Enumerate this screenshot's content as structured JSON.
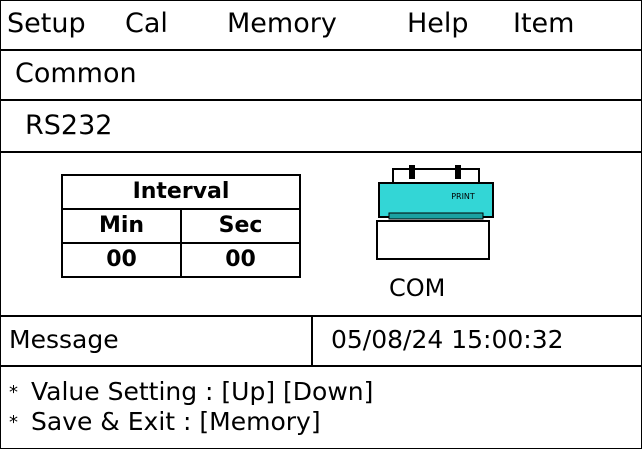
{
  "menu": {
    "items": [
      {
        "label": "Setup"
      },
      {
        "label": "Cal"
      },
      {
        "label": "Memory"
      },
      {
        "label": "Help"
      },
      {
        "label": "Item"
      }
    ]
  },
  "section": {
    "title": "Common",
    "subtitle": "RS232"
  },
  "interval": {
    "header": "Interval",
    "min_label": "Min",
    "sec_label": "Sec",
    "min_value": "00",
    "sec_value": "00"
  },
  "printer": {
    "icon_text": "PRINT",
    "port_label": "COM",
    "color": "#33d6d6"
  },
  "status": {
    "message_label": "Message",
    "datetime": "05/08/24 15:00:32"
  },
  "help": {
    "line1": "Value Setting : [Up] [Down]",
    "line2": "Save &  Exit : [Memory]",
    "bullet": "*"
  }
}
